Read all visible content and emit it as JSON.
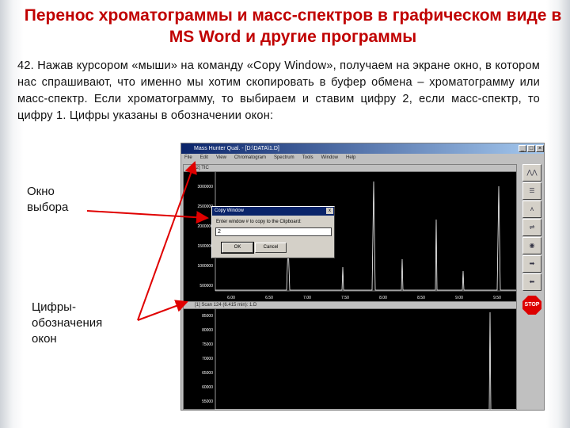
{
  "title": "Перенос хроматограммы и масс-спектров в графическом виде в MS Word и другие программы",
  "paragraph": "42. Нажав курсором «мыши» на команду «Copy Window», получаем на экране окно, в котором нас спрашивают, что именно мы хотим скопировать в буфер обмена – хроматограмму или масс-спектр. Если хроматограмму, то выбираем и ставим цифру 2, если масс-спектр, то цифру 1. Цифры указаны в обозначении окон:",
  "labels": {
    "window_choice": "Окно выбора",
    "digits_line1": "Цифры-",
    "digits_line2": "обозначения",
    "digits_line3": "окон"
  },
  "app": {
    "window_title": "Mass Hunter Qual. - [D:\\DATA\\1.D]",
    "menu": [
      "File",
      "Edit",
      "View",
      "Chromatogram",
      "Spectrum",
      "Tools",
      "Window",
      "Help"
    ],
    "pane_top_header": "[2] TIC",
    "pane_bottom_header": "[1] Scan 124 (6.415 min): 1.D",
    "dialog": {
      "title": "Copy Window",
      "close": "x",
      "prompt": "Enter window # to copy to the Clipboard:",
      "value": "2",
      "ok": "OK",
      "cancel": "Cancel"
    },
    "top_y_ticks": [
      "3000000",
      "2500000",
      "2000000",
      "1500000",
      "1000000",
      "500000"
    ],
    "top_x_ticks": [
      "6.00",
      "6.50",
      "7.00",
      "7.50",
      "8.00",
      "8.50",
      "9.00",
      "9.50"
    ],
    "bottom_y_ticks": [
      "85000",
      "80000",
      "75000",
      "70000",
      "65000",
      "60000",
      "55000"
    ],
    "stop_label": "STOP",
    "colors": {
      "accent_red": "#c00000",
      "arrow_red": "#e00000",
      "trace_white": "#ffffff"
    }
  }
}
